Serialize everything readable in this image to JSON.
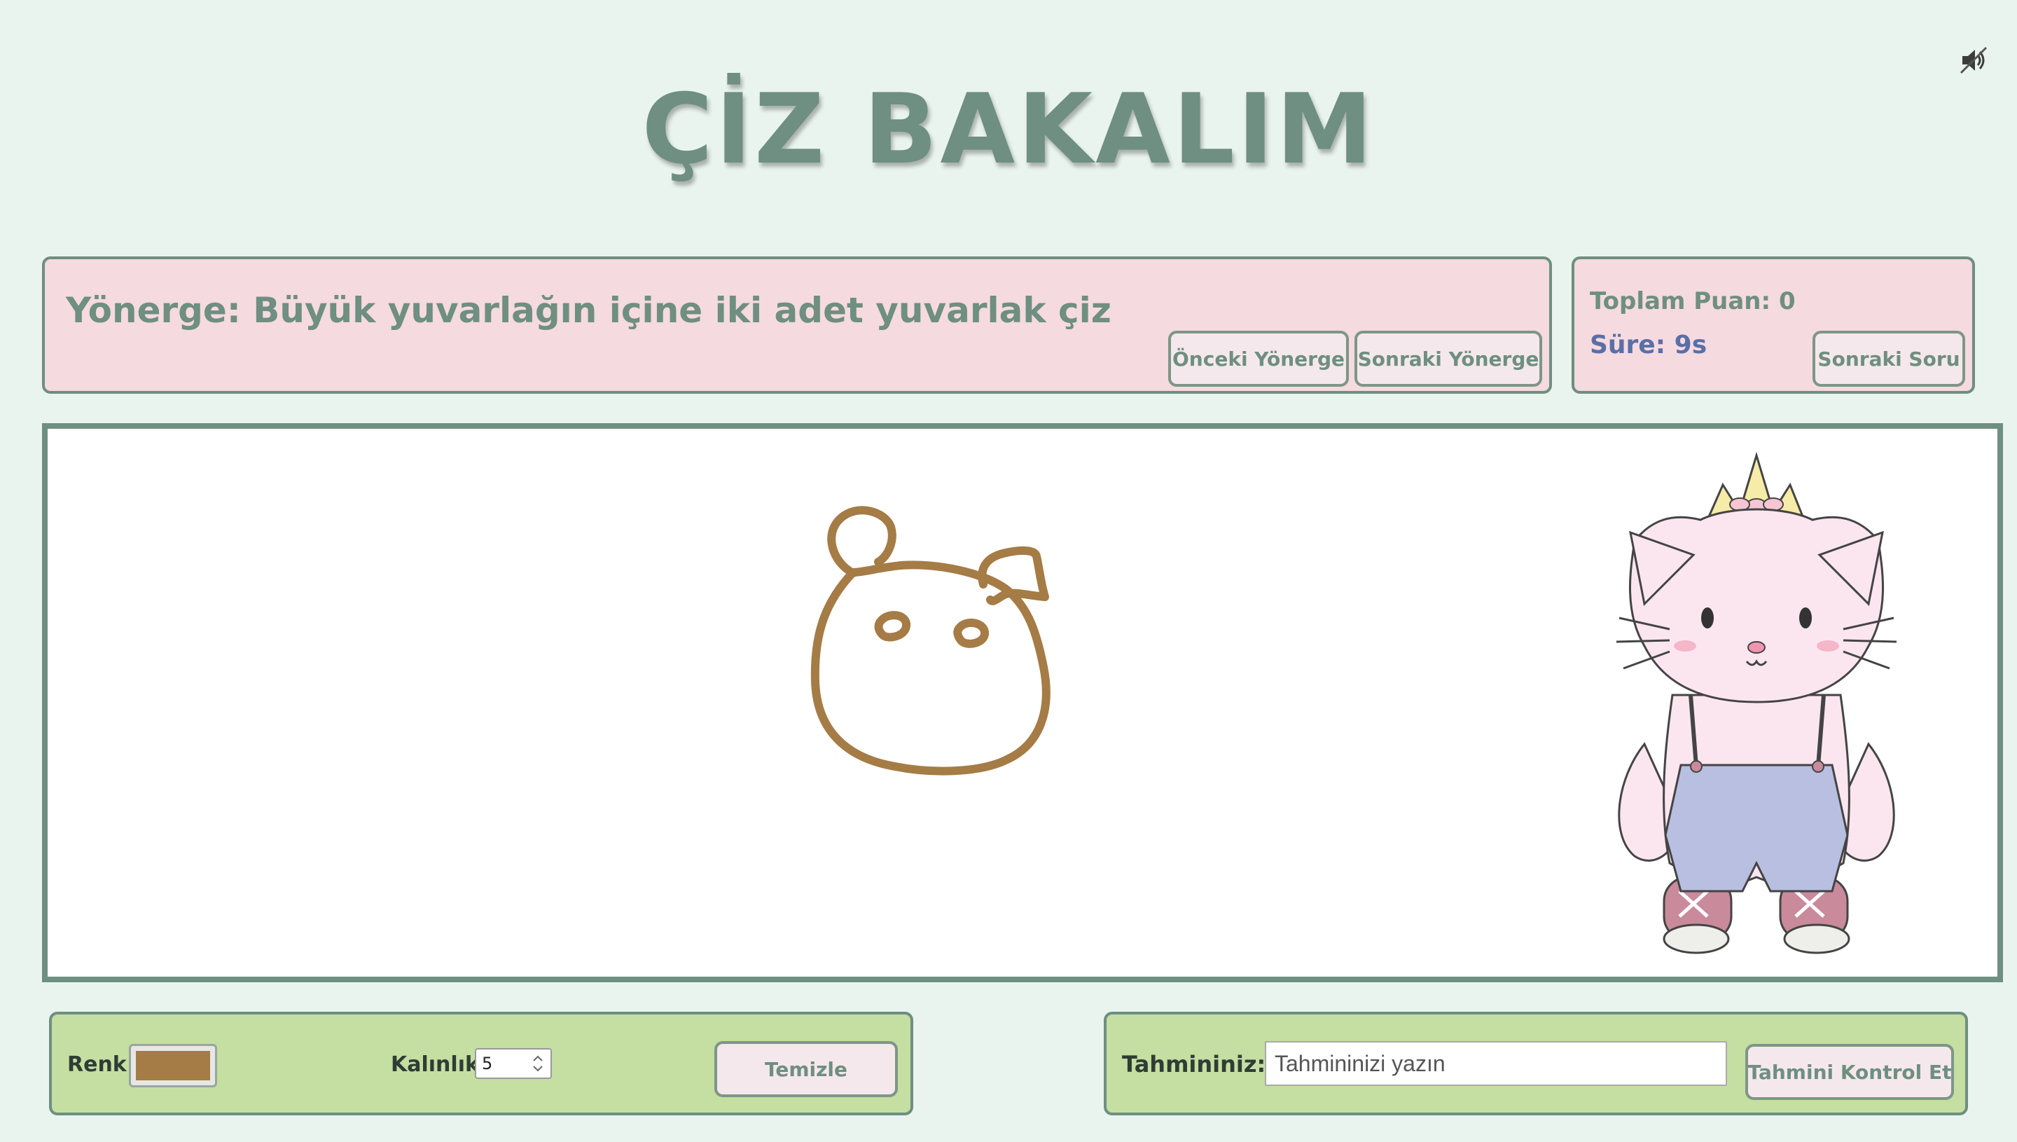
{
  "app": {
    "title": "ÇİZ BAKALIM",
    "sound_icon": "speaker-icon"
  },
  "instruction": {
    "text": "Yönerge: Büyük yuvarlağın içine iki adet yuvarlak çiz",
    "prev_button": "Önceki Yönerge",
    "next_button": "Sonraki Yönerge"
  },
  "score": {
    "total_label": "Toplam Puan: 0",
    "timer_label": "Süre: 9s",
    "next_question_button": "Sonraki Soru"
  },
  "tools": {
    "color_label": "Renk:",
    "color_value": "#a57c46",
    "thickness_label": "Kalınlık:",
    "thickness_value": "5",
    "clear_button": "Temizle"
  },
  "guess": {
    "label": "Tahmininiz:",
    "placeholder": "Tahmininizi yazın",
    "check_button": "Tahmini Kontrol Et"
  },
  "colors": {
    "background": "#eaf4ee",
    "accent": "#6e8f81",
    "pink_panel": "#f5dadf",
    "green_panel": "#c5dea1",
    "stroke": "#a57c46",
    "timer": "#5a6fa8"
  }
}
